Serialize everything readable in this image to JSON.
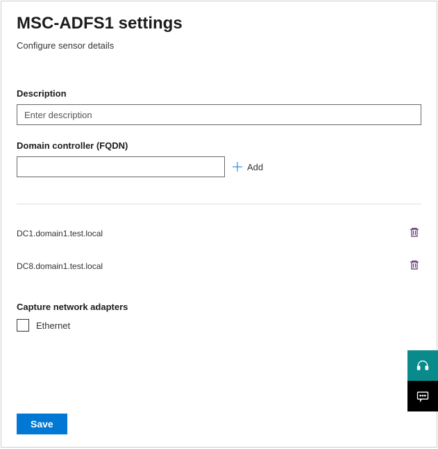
{
  "header": {
    "title": "MSC-ADFS1 settings",
    "subtitle": "Configure sensor details"
  },
  "description": {
    "label": "Description",
    "value": "",
    "placeholder": "Enter description"
  },
  "fqdn": {
    "label": "Domain controller (FQDN)",
    "value": "",
    "add_label": "Add"
  },
  "dc_list": [
    {
      "name": "DC1.domain1.test.local"
    },
    {
      "name": "DC8.domain1.test.local"
    }
  ],
  "adapters": {
    "label": "Capture network adapters",
    "options": [
      {
        "label": "Ethernet",
        "checked": false
      }
    ]
  },
  "actions": {
    "save": "Save"
  }
}
